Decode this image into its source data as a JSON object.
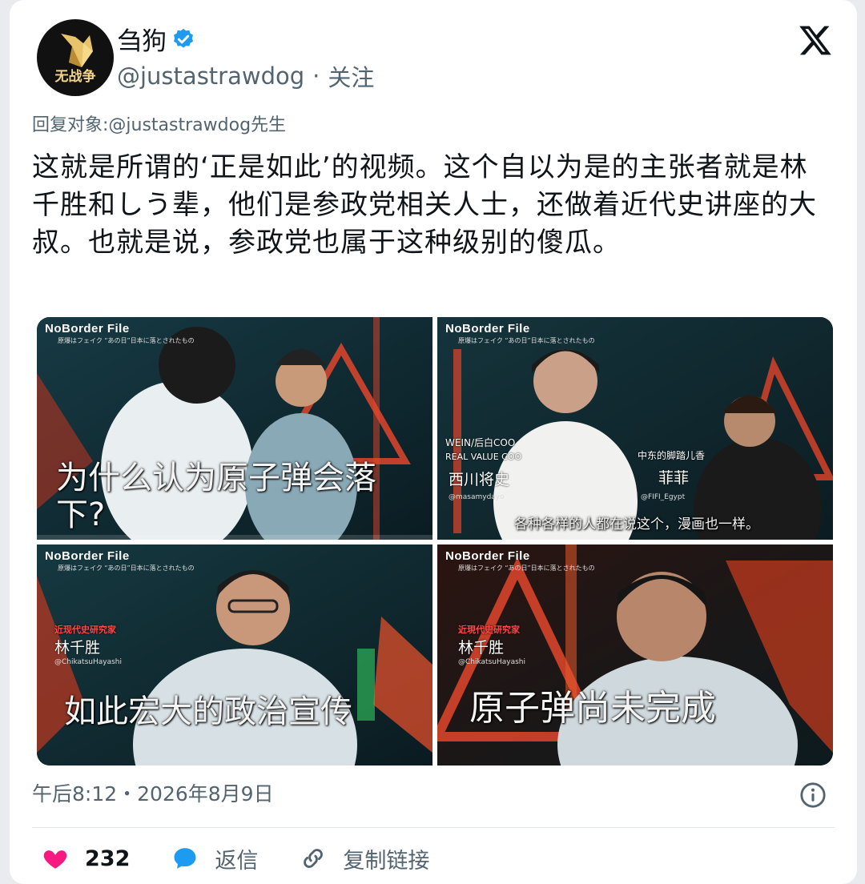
{
  "author": {
    "avatar_text": "无战争",
    "display_name": "刍狗",
    "handle": "@justastrawdog",
    "separator": "·",
    "follow_label": "关注"
  },
  "reply_to": "回复对象:@justastrawdog先生",
  "tweet_text": "这就是所谓的‘正是如此’的视频。这个自以为是的主张者就是林千胜和しう辈，他们是参政党相关人士，还做着近代史讲座的大叔。也就是说，参政党也属于这种级别的傻瓜。",
  "media": {
    "show_logo": "NoBorder File",
    "show_sub": "原爆はフェイク “あの日”日本に落とされたもの",
    "tiles": [
      {
        "caption": "为什么认为原子弹会落下?"
      },
      {
        "caption": "各种各样的人都在说这个，漫画也一样。",
        "guest1_title": "WEIN/后白COO",
        "guest1_title2": "REAL VALUE COO",
        "guest1_name": "西川将史",
        "guest1_sns": "@masamydayo",
        "guest2_title": "中东的脚踏儿香",
        "guest2_name": "菲菲",
        "guest2_sns": "@FIFI_Egypt"
      },
      {
        "caption": "如此宏大的政治宣传",
        "speaker_title": "近现代史研究家",
        "speaker_name": "林千胜",
        "speaker_sns": "@ChikatsuHayashi"
      },
      {
        "caption": "原子弹尚未完成",
        "speaker_title": "近現代史研究家",
        "speaker_name": "林千胜",
        "speaker_sns": "@ChikatsuHayashi"
      }
    ]
  },
  "timestamp": "午后8:12・2026年8月9日",
  "actions": {
    "like_count": "232",
    "reply_label": "返信",
    "copy_link_label": "复制链接"
  },
  "colors": {
    "like": "#f91880",
    "reply": "#1d9bf0",
    "verified": "#1d9bf0",
    "secondary_text": "#536471"
  }
}
